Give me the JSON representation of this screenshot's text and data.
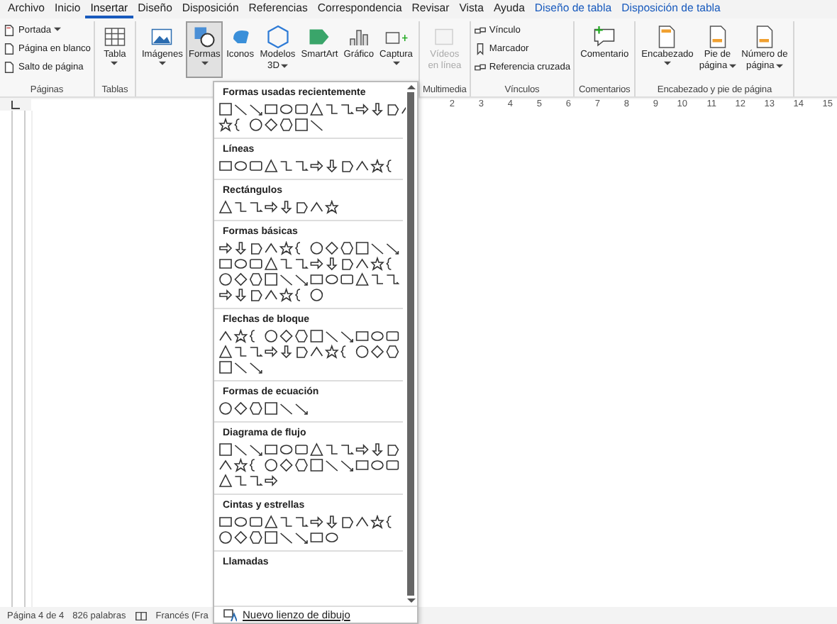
{
  "tabs": [
    {
      "label": "Archivo",
      "selected": false,
      "kind": "main"
    },
    {
      "label": "Inicio",
      "selected": false,
      "kind": "main"
    },
    {
      "label": "Insertar",
      "selected": true,
      "kind": "main"
    },
    {
      "label": "Diseño",
      "selected": false,
      "kind": "main"
    },
    {
      "label": "Disposición",
      "selected": false,
      "kind": "main"
    },
    {
      "label": "Referencias",
      "selected": false,
      "kind": "main"
    },
    {
      "label": "Correspondencia",
      "selected": false,
      "kind": "main"
    },
    {
      "label": "Revisar",
      "selected": false,
      "kind": "main"
    },
    {
      "label": "Vista",
      "selected": false,
      "kind": "main"
    },
    {
      "label": "Ayuda",
      "selected": false,
      "kind": "main"
    },
    {
      "label": "Diseño de tabla",
      "selected": false,
      "kind": "context"
    },
    {
      "label": "Disposición de tabla",
      "selected": false,
      "kind": "context"
    }
  ],
  "ribbon": {
    "groups": [
      {
        "label": "Páginas",
        "items": [
          {
            "kind": "small",
            "lines": [
              "Portada"
            ],
            "dropdown": true
          },
          {
            "kind": "small",
            "lines": [
              "Página en blanco"
            ],
            "dropdown": false
          },
          {
            "kind": "small",
            "lines": [
              "Salto de página"
            ],
            "dropdown": false
          }
        ]
      },
      {
        "label": "Tablas",
        "items": [
          {
            "kind": "large",
            "lines": [
              "Tabla"
            ],
            "dropdown": true,
            "selected": false,
            "disabled": false
          }
        ]
      },
      {
        "items": [
          {
            "kind": "large",
            "lines": [
              "Imágenes"
            ],
            "dropdown": true,
            "selected": false,
            "disabled": false
          },
          {
            "kind": "large",
            "lines": [
              "Formas"
            ],
            "dropdown": true,
            "selected": true,
            "disabled": false
          },
          {
            "kind": "large",
            "lines": [
              "Iconos"
            ],
            "dropdown": false,
            "selected": false,
            "disabled": false
          },
          {
            "kind": "large",
            "lines": [
              "Modelos",
              "3D"
            ],
            "dropdown": true,
            "selected": false,
            "disabled": false
          },
          {
            "kind": "large",
            "lines": [
              "SmartArt"
            ],
            "dropdown": false,
            "selected": false,
            "disabled": false
          },
          {
            "kind": "large",
            "lines": [
              "Gráfico"
            ],
            "dropdown": false,
            "selected": false,
            "disabled": false
          },
          {
            "kind": "large",
            "lines": [
              "Captura"
            ],
            "dropdown": true,
            "selected": false,
            "disabled": false
          }
        ]
      },
      {
        "label": "Multimedia",
        "items": [
          {
            "kind": "large",
            "lines": [
              "Vídeos",
              "en línea"
            ],
            "dropdown": false,
            "selected": false,
            "disabled": true
          }
        ]
      },
      {
        "label": "Vínculos",
        "items": [
          {
            "kind": "small",
            "lines": [
              "Vínculo"
            ],
            "dropdown": false
          },
          {
            "kind": "small",
            "lines": [
              "Marcador"
            ],
            "dropdown": false
          },
          {
            "kind": "small",
            "lines": [
              "Referencia cruzada"
            ],
            "dropdown": false
          }
        ]
      },
      {
        "label": "Comentarios",
        "items": [
          {
            "kind": "large",
            "lines": [
              "Comentario"
            ],
            "dropdown": false,
            "selected": false,
            "disabled": false
          }
        ]
      },
      {
        "label": "Encabezado y pie de página",
        "items": [
          {
            "kind": "large",
            "lines": [
              "Encabezado"
            ],
            "dropdown": true,
            "selected": false,
            "disabled": false
          },
          {
            "kind": "large",
            "lines": [
              "Pie de",
              "página"
            ],
            "dropdown": true,
            "selected": false,
            "disabled": false
          },
          {
            "kind": "large",
            "lines": [
              "Número de",
              "página"
            ],
            "dropdown": true,
            "selected": false,
            "disabled": false
          }
        ]
      }
    ]
  },
  "ruler": {
    "numbers": [
      "2",
      "3",
      "4",
      "5",
      "6",
      "7",
      "8",
      "9",
      "10",
      "11",
      "12",
      "13",
      "14",
      "15"
    ]
  },
  "status_bar": {
    "page": "Página 4 de 4",
    "words": "826 palabras",
    "language": "Francés (Fra"
  },
  "shapes_menu": {
    "sections": [
      {
        "title": "Formas usadas recientemente"
      },
      {
        "title": "Líneas"
      },
      {
        "title": "Rectángulos"
      },
      {
        "title": "Formas básicas"
      },
      {
        "title": "Flechas de bloque"
      },
      {
        "title": "Formas de ecuación"
      },
      {
        "title": "Diagrama de flujo"
      },
      {
        "title": "Cintas y estrellas"
      },
      {
        "title": "Llamadas"
      }
    ],
    "footer": "Nuevo lienzo de dibujo"
  }
}
